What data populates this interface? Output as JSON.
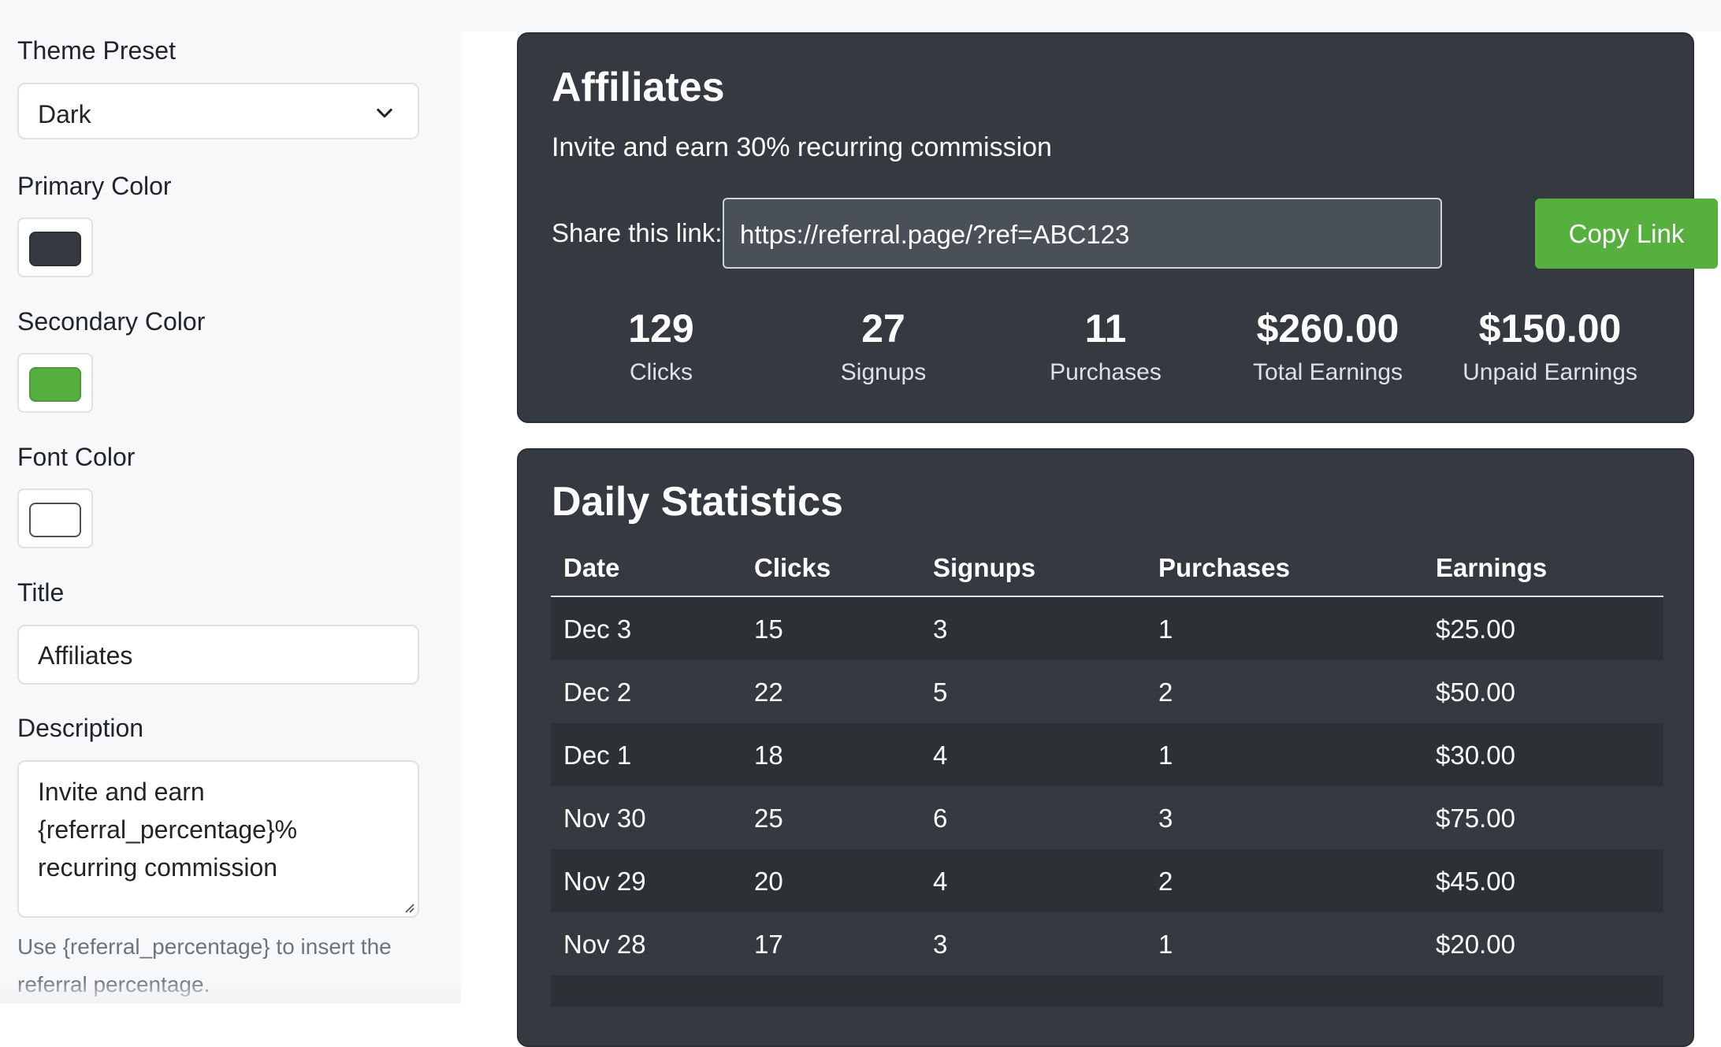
{
  "settings": {
    "theme_preset_label": "Theme Preset",
    "theme_preset_value": "Dark",
    "primary_color_label": "Primary Color",
    "primary_color": "#343a40",
    "secondary_color_label": "Secondary Color",
    "secondary_color": "#56b03e",
    "font_color_label": "Font Color",
    "font_color": "#ffffff",
    "title_label": "Title",
    "title_value": "Affiliates",
    "description_label": "Description",
    "description_value": "Invite and earn {referral_percentage}% recurring commission",
    "description_help": "Use {referral_percentage} to insert the referral percentage."
  },
  "affiliates_card": {
    "title": "Affiliates",
    "subtitle": "Invite and earn 30% recurring commission",
    "share_label": "Share this link:",
    "referral_link": "https://referral.page/?ref=ABC123",
    "copy_button": "Copy Link",
    "stats": [
      {
        "value": "129",
        "label": "Clicks"
      },
      {
        "value": "27",
        "label": "Signups"
      },
      {
        "value": "11",
        "label": "Purchases"
      },
      {
        "value": "$260.00",
        "label": "Total Earnings"
      },
      {
        "value": "$150.00",
        "label": "Unpaid Earnings"
      }
    ]
  },
  "daily_stats": {
    "title": "Daily Statistics",
    "columns": [
      "Date",
      "Clicks",
      "Signups",
      "Purchases",
      "Earnings"
    ],
    "rows": [
      [
        "Dec 3",
        "15",
        "3",
        "1",
        "$25.00"
      ],
      [
        "Dec 2",
        "22",
        "5",
        "2",
        "$50.00"
      ],
      [
        "Dec 1",
        "18",
        "4",
        "1",
        "$30.00"
      ],
      [
        "Nov 30",
        "25",
        "6",
        "3",
        "$75.00"
      ],
      [
        "Nov 29",
        "20",
        "4",
        "2",
        "$45.00"
      ],
      [
        "Nov 28",
        "17",
        "3",
        "1",
        "$20.00"
      ]
    ]
  },
  "icons": {
    "dropdown": "chevron-down-icon",
    "resize": "resize-grip-icon"
  }
}
